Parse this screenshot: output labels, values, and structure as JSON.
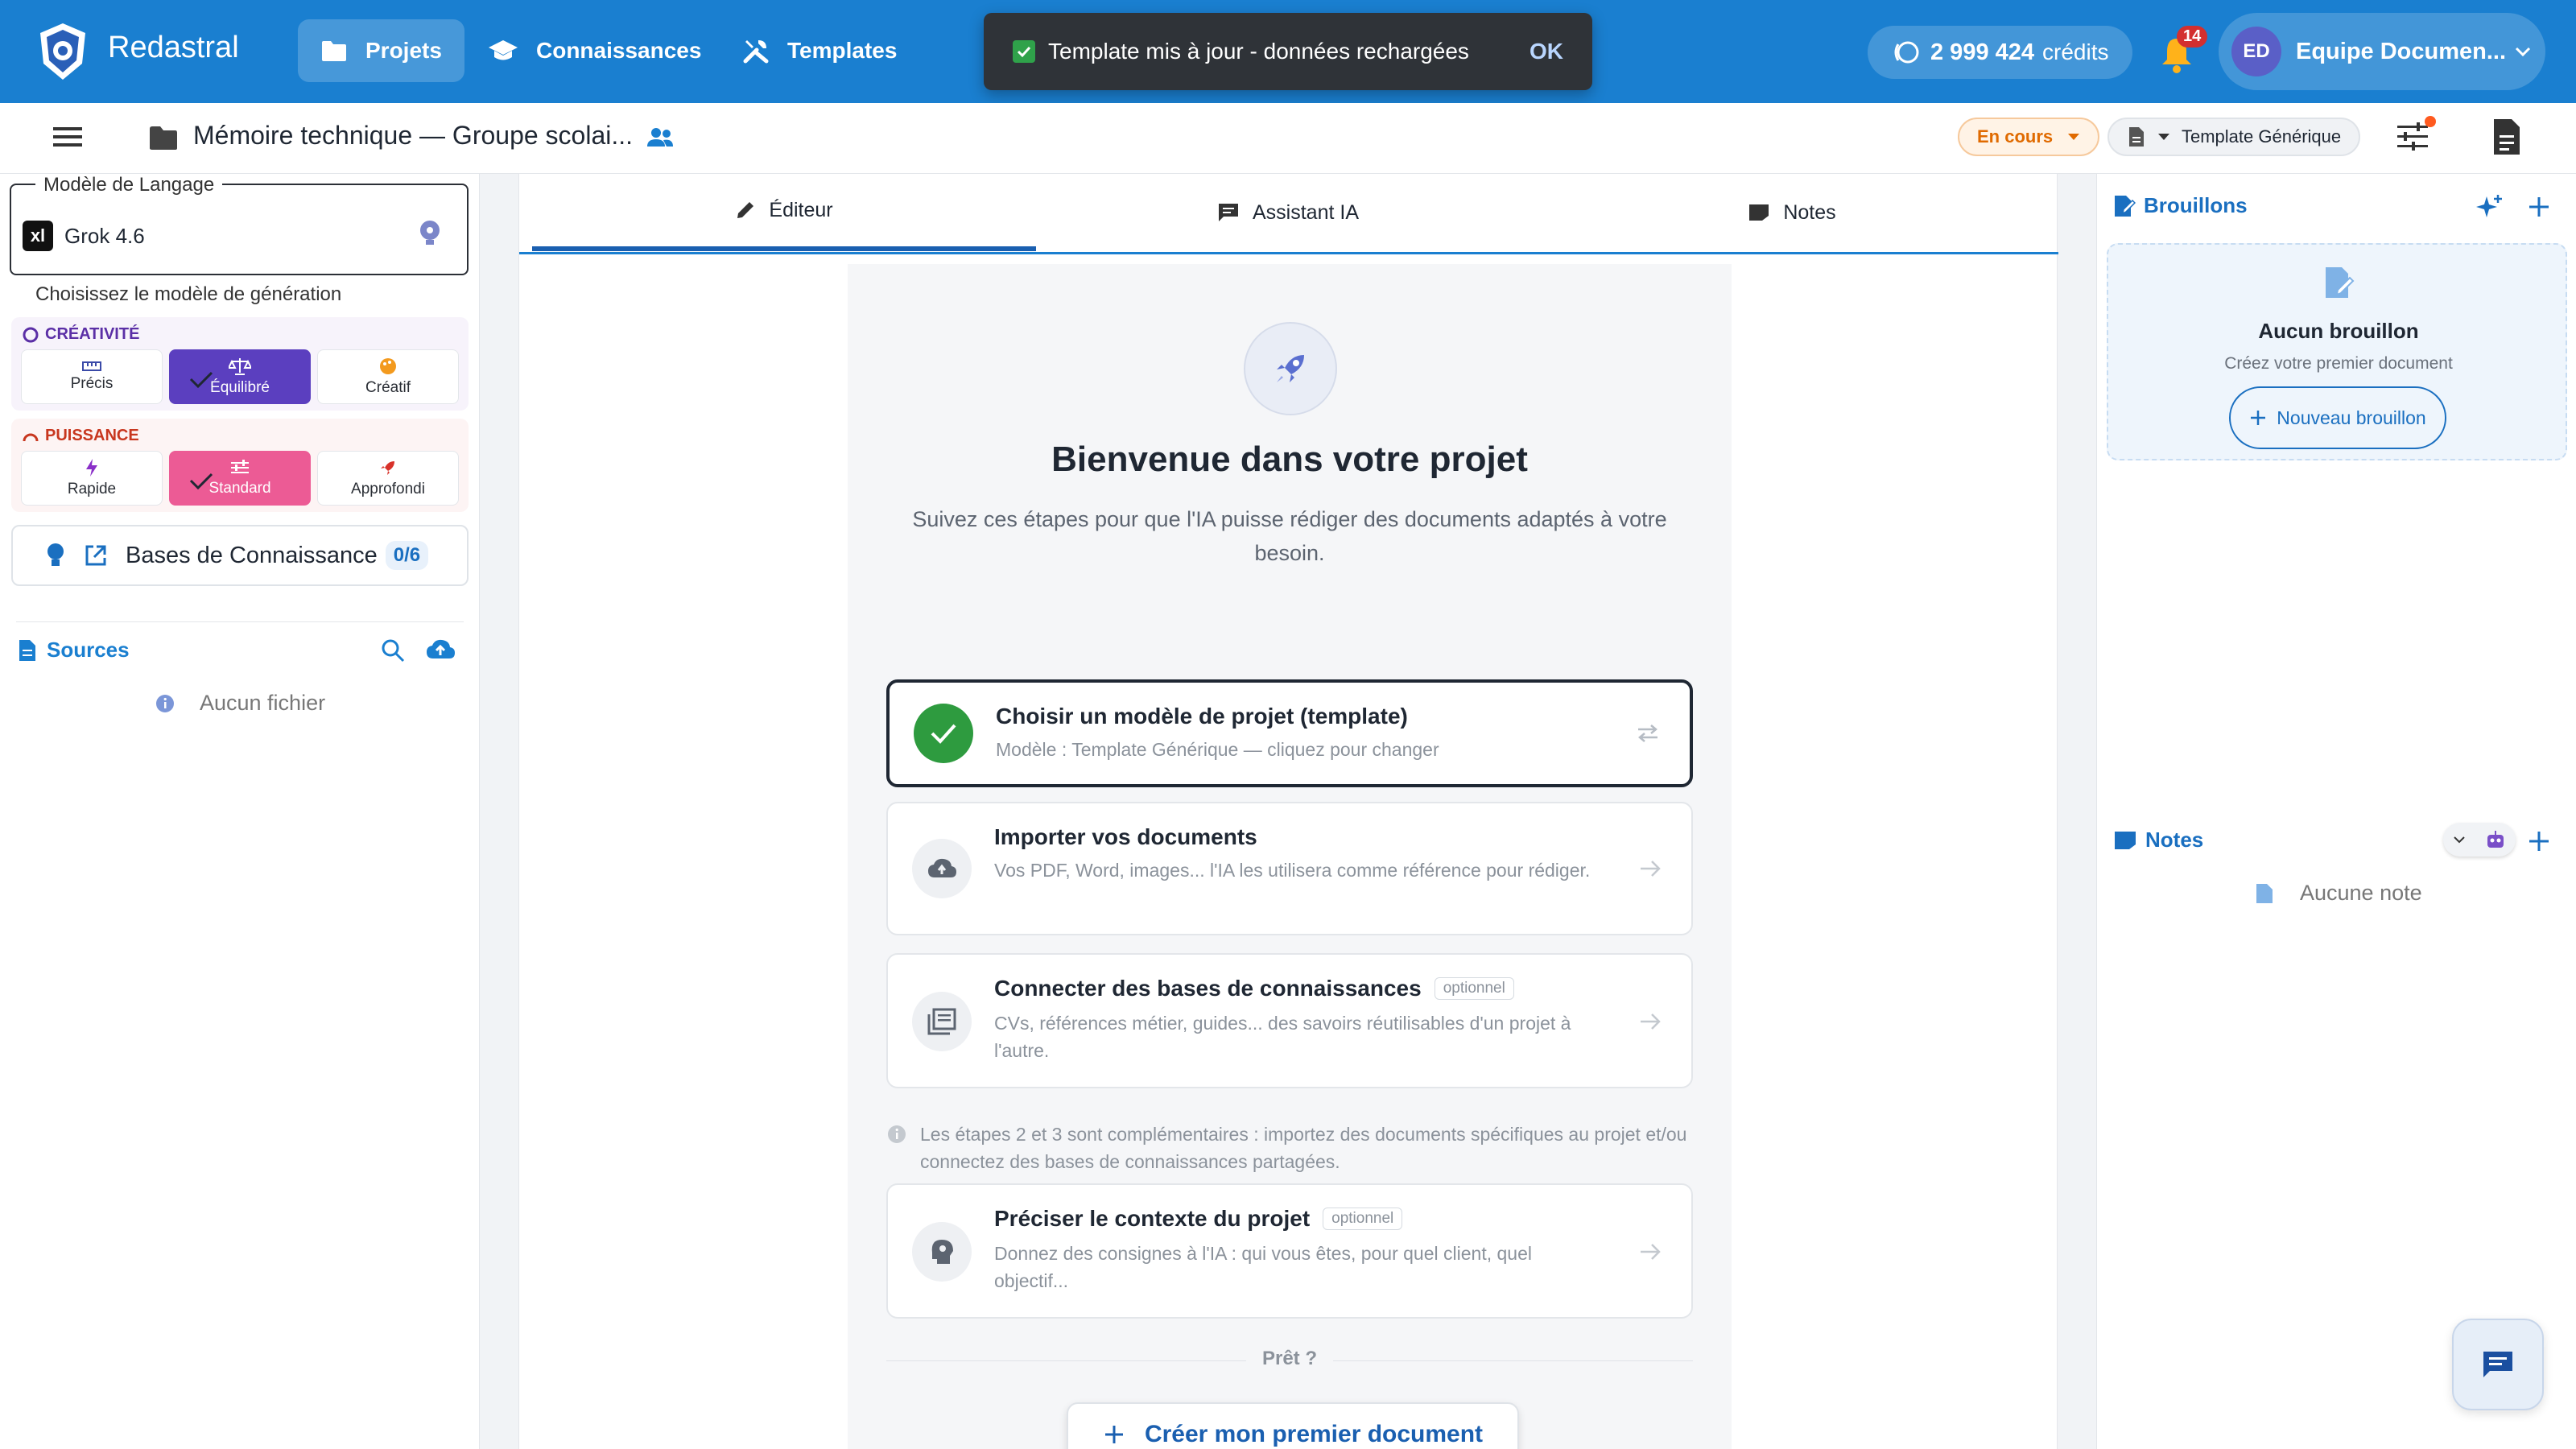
{
  "app": {
    "name": "Redastral"
  },
  "nav": {
    "projects": "Projets",
    "knowledge": "Connaissances",
    "templates": "Templates"
  },
  "toast": {
    "message": "Template mis à jour - données rechargées",
    "action": "OK"
  },
  "credits": {
    "amount": "2 999 424",
    "label": "crédits"
  },
  "notifications": {
    "count": "14"
  },
  "user": {
    "initials": "ED",
    "name": "Equipe Documen..."
  },
  "project": {
    "title": "Mémoire technique — Groupe scolai...",
    "status": "En cours",
    "template": "Template Générique"
  },
  "left": {
    "model_legend": "Modèle de Langage",
    "model_logo": "xl",
    "model_name": "Grok 4.6",
    "model_caption": "Choisissez le modèle de génération",
    "creativity": {
      "label": "CRÉATIVITÉ",
      "options": [
        "Précis",
        "Équilibré",
        "Créatif"
      ],
      "selected": "Équilibré"
    },
    "power": {
      "label": "PUISSANCE",
      "options": [
        "Rapide",
        "Standard",
        "Approfondi"
      ],
      "selected": "Standard"
    },
    "knowledge_bases": {
      "label": "Bases de Connaissance",
      "count": "0/6"
    },
    "sources": {
      "title": "Sources",
      "empty": "Aucun fichier"
    }
  },
  "tabs": {
    "editor": "Éditeur",
    "assistant": "Assistant IA",
    "notes": "Notes"
  },
  "welcome": {
    "title": "Bienvenue dans votre projet",
    "subtitle": "Suivez ces étapes pour que l'IA puisse rédiger des documents adaptés à votre besoin.",
    "steps": [
      {
        "title": "Choisir un modèle de projet (template)",
        "desc": "Modèle : Template Générique — cliquez pour changer",
        "optional": "",
        "done": true
      },
      {
        "title": "Importer vos documents",
        "desc": "Vos PDF, Word, images... l'IA les utilisera comme référence pour rédiger.",
        "optional": "",
        "done": false
      },
      {
        "title": "Connecter des bases de connaissances",
        "desc": "CVs, références métier, guides... des savoirs réutilisables d'un projet à l'autre.",
        "optional": "optionnel",
        "done": false
      },
      {
        "title": "Préciser le contexte du projet",
        "desc": "Donnez des consignes à l'IA : qui vous êtes, pour quel client, quel objectif...",
        "optional": "optionnel",
        "done": false
      }
    ],
    "info": "Les étapes 2 et 3 sont complémentaires : importez des documents spécifiques au projet et/ou connectez des bases de connaissances partagées.",
    "ready": "Prêt ?",
    "create_button": "Créer mon premier document"
  },
  "right": {
    "drafts": {
      "title": "Brouillons",
      "empty_title": "Aucun brouillon",
      "empty_sub": "Créez votre premier document",
      "new_button": "Nouveau brouillon"
    },
    "notes": {
      "title": "Notes",
      "empty": "Aucune note"
    }
  },
  "colors": {
    "primary": "#1a7fd0",
    "creativity_selected": "#5b3fbf",
    "power_selected": "#ec5b95",
    "success": "#2e9b3f",
    "status": "#e06a00"
  }
}
